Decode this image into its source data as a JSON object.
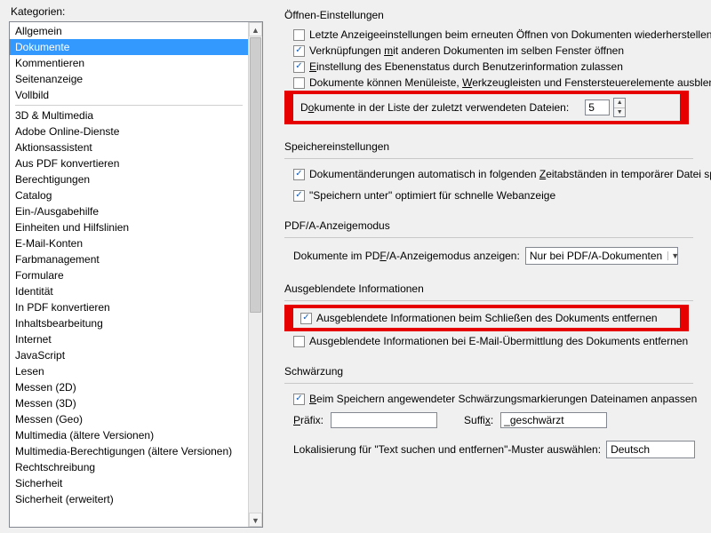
{
  "left": {
    "title": "Kategorien:",
    "items_pre": [
      "Allgemein",
      "Dokumente",
      "Kommentieren",
      "Seitenanzeige",
      "Vollbild"
    ],
    "selected": "Dokumente",
    "items_post": [
      "3D & Multimedia",
      "Adobe Online-Dienste",
      "Aktionsassistent",
      "Aus PDF konvertieren",
      "Berechtigungen",
      "Catalog",
      "Ein-/Ausgabehilfe",
      "Einheiten und Hilfslinien",
      "E-Mail-Konten",
      "Farbmanagement",
      "Formulare",
      "Identität",
      "In PDF konvertieren",
      "Inhaltsbearbeitung",
      "Internet",
      "JavaScript",
      "Lesen",
      "Messen (2D)",
      "Messen (3D)",
      "Messen (Geo)",
      "Multimedia (ältere Versionen)",
      "Multimedia-Berechtigungen (ältere Versionen)",
      "Rechtschreibung",
      "Sicherheit",
      "Sicherheit (erweitert)"
    ]
  },
  "open": {
    "title": "Öffnen-Einstellungen",
    "restore": "Letzte Anzeigeeinstellungen beim erneuten Öffnen von Dokumenten wiederherstellen",
    "links_pre": "Verknüpfungen ",
    "links_u": "m",
    "links_post": "it anderen Dokumenten im selben Fenster öffnen",
    "layer_pre": "",
    "layer_u": "E",
    "layer_post": "instellung des Ebenenstatus durch Benutzerinformation zulassen",
    "hidemenu_pre": "Dokumente können Menüleiste, ",
    "hidemenu_u": "W",
    "hidemenu_post": "erkzeugleisten und Fenstersteuerelemente ausblenden",
    "recent_pre": "D",
    "recent_u": "o",
    "recent_post": "kumente in der Liste der zuletzt verwendeten Dateien:",
    "recent_value": "5"
  },
  "save": {
    "title": "Speichereinstellungen",
    "autosave_pre": "Dokumentänderungen automatisch in folgenden ",
    "autosave_u": "Z",
    "autosave_post": "eitabständen in temporärer Datei spei",
    "fastweb": "\"Speichern unter\" optimiert für schnelle Webanzeige"
  },
  "pdfa": {
    "title": "PDF/A-Anzeigemodus",
    "label_pre": "Dokumente im PD",
    "label_u": "F",
    "label_post": "/A-Anzeigemodus anzeigen:",
    "select_value": "Nur bei PDF/A-Dokumenten"
  },
  "hidden": {
    "title": "Ausgeblendete Informationen",
    "close": "Ausgeblendete Informationen beim Schließen des Dokuments entfernen",
    "email": "Ausgeblendete Informationen bei E-Mail-Übermittlung des Dokuments entfernen"
  },
  "redact": {
    "title": "Schwärzung",
    "adjust_pre": "",
    "adjust_u": "B",
    "adjust_post": "eim Speichern angewendeter Schwärzungsmarkierungen Dateinamen anpassen",
    "prefix_pre": "",
    "prefix_u": "P",
    "prefix_post": "räfix:",
    "prefix_value": "",
    "suffix_pre": "Suffi",
    "suffix_u": "x",
    "suffix_post": ":",
    "suffix_value": "_geschwärzt",
    "locale_label": "Lokalisierung für \"Text suchen und entfernen\"-Muster auswählen:",
    "locale_value": "Deutsch"
  }
}
